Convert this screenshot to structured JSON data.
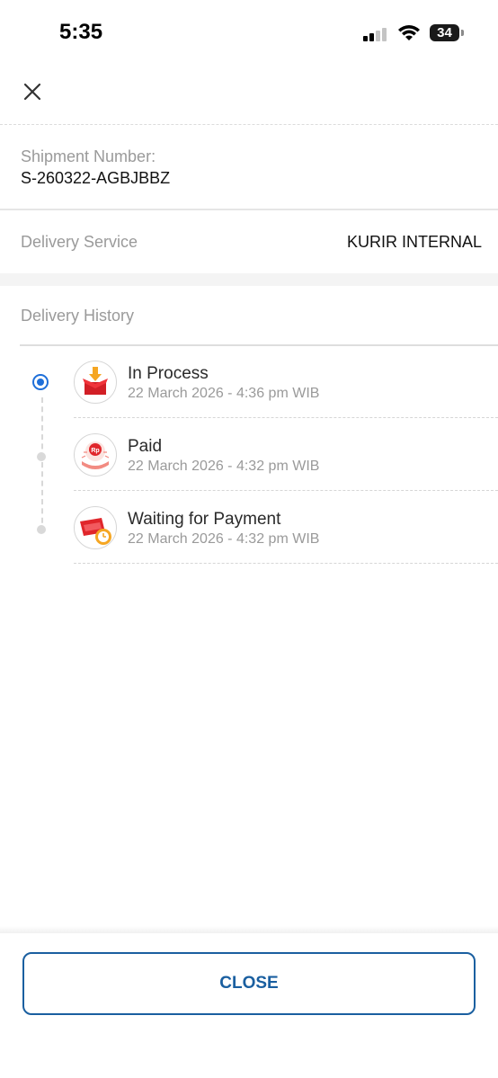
{
  "status_bar": {
    "time": "5:35",
    "battery": "34"
  },
  "shipment": {
    "label": "Shipment Number:",
    "value": "S-260322-AGBJBBZ"
  },
  "delivery_service": {
    "label": "Delivery Service",
    "value": "KURIR INTERNAL"
  },
  "history": {
    "label": "Delivery History",
    "items": [
      {
        "title": "In Process",
        "time": "22 March 2026 - 4:36 pm WIB",
        "icon": "box-arrow-icon",
        "active": true
      },
      {
        "title": "Paid",
        "time": "22 March 2026 - 4:32 pm WIB",
        "icon": "paid-coin-hand-icon",
        "active": false
      },
      {
        "title": "Waiting for Payment",
        "time": "22 March 2026 - 4:32 pm WIB",
        "icon": "waiting-payment-clock-icon",
        "active": false
      }
    ]
  },
  "footer": {
    "close_label": "CLOSE"
  },
  "colors": {
    "accent": "#1a5fa0",
    "active_dot": "#1e6fd9",
    "icon_red": "#e0262b"
  }
}
